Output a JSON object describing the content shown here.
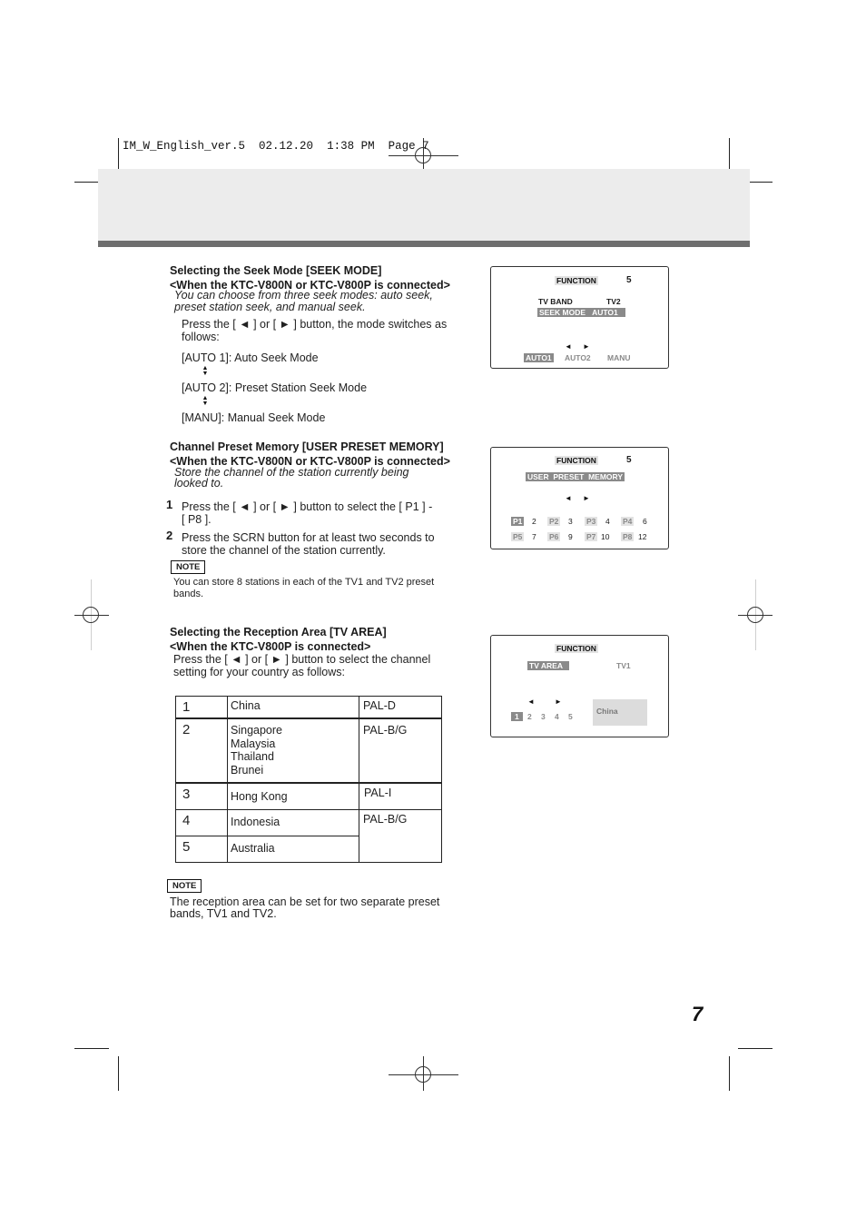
{
  "slug": {
    "file": "IM_W_English_ver.5",
    "date": "02.12.20",
    "time": "1:38 PM",
    "page_label": "Page 7"
  },
  "seek_mode": {
    "title": "Selecting the Seek Mode [SEEK MODE]",
    "condition": "<When the KTC-V800N or KTC-V800P is connected>",
    "intro_line1": "You can choose from three seek modes: auto seek,",
    "intro_line2": "preset station seek, and manual seek.",
    "instruction_line1": "Press the [ ◄ ] or [ ► ] button, the mode switches as",
    "instruction_line2": "follows:",
    "modes": [
      "[AUTO 1]: Auto Seek Mode",
      "[AUTO 2]: Preset Station Seek Mode",
      "[MANU]: Manual Seek Mode"
    ],
    "screen": {
      "function_label": "FUNCTION",
      "function_num": "5",
      "tv_band_label": "TV BAND",
      "tv_band_value": "TV2",
      "seek_mode_label": "SEEK MODE",
      "seek_mode_value": "AUTO1",
      "left_arrow": "◄",
      "right_arrow": "►",
      "options": [
        "AUTO1",
        "AUTO2",
        "MANU"
      ],
      "selected_option": "AUTO1"
    }
  },
  "preset_memory": {
    "title": "Channel Preset Memory [USER PRESET MEMORY]",
    "condition": "<When the KTC-V800N or KTC-V800P is connected>",
    "intro_line1": "Store the channel of the station currently being",
    "intro_line2": "looked to.",
    "steps": [
      {
        "num": "1",
        "line1": "Press the [ ◄ ] or [ ► ] button to select the [ P1 ] -",
        "line2": "[ P8 ]."
      },
      {
        "num": "2",
        "line1": "Press the SCRN button for at least two seconds to",
        "line2": "store the channel of the station currently."
      }
    ],
    "note_label": "NOTE",
    "note_line1": "You can store 8 stations in each of the TV1 and TV2 preset",
    "note_line2": "bands.",
    "screen": {
      "function_label": "FUNCTION",
      "function_num": "5",
      "mode_label": "USER  PRESET  MEMORY",
      "left_arrow": "◄",
      "right_arrow": "►",
      "presets": [
        {
          "label": "P1",
          "channel": "2",
          "selected": true
        },
        {
          "label": "P2",
          "channel": "3"
        },
        {
          "label": "P3",
          "channel": "4"
        },
        {
          "label": "P4",
          "channel": "6"
        },
        {
          "label": "P5",
          "channel": "7"
        },
        {
          "label": "P6",
          "channel": "9"
        },
        {
          "label": "P7",
          "channel": "10"
        },
        {
          "label": "P8",
          "channel": "12"
        }
      ]
    }
  },
  "tv_area": {
    "title": "Selecting the Reception Area [TV AREA]",
    "condition": "<When the KTC-V800P is connected>",
    "instruction_line1": "Press the [ ◄ ] or [ ► ] button to select the channel",
    "instruction_line2": "setting for your country as follows:",
    "table": [
      {
        "num": "1",
        "countries": [
          "China"
        ],
        "system": "PAL-D"
      },
      {
        "num": "2",
        "countries": [
          "Singapore",
          "Malaysia",
          "Thailand",
          "Brunei"
        ],
        "system": "PAL-B/G"
      },
      {
        "num": "3",
        "countries": [
          "Hong Kong"
        ],
        "system": "PAL-I"
      },
      {
        "num": "4",
        "countries": [
          "Indonesia"
        ],
        "system": "PAL-B/G"
      },
      {
        "num": "5",
        "countries": [
          "Australia"
        ],
        "system": ""
      }
    ],
    "note_label": "NOTE",
    "note_line1": "The reception area can be set for two separate preset",
    "note_line2": "bands, TV1 and TV2.",
    "screen": {
      "function_label": "FUNCTION",
      "area_label": "TV AREA",
      "band_value": "TV1",
      "left_arrow": "◄",
      "right_arrow": "►",
      "areas": [
        "1",
        "2",
        "3",
        "4",
        "5"
      ],
      "selected_area": "1",
      "country_display": "China"
    }
  },
  "page_number": "7"
}
